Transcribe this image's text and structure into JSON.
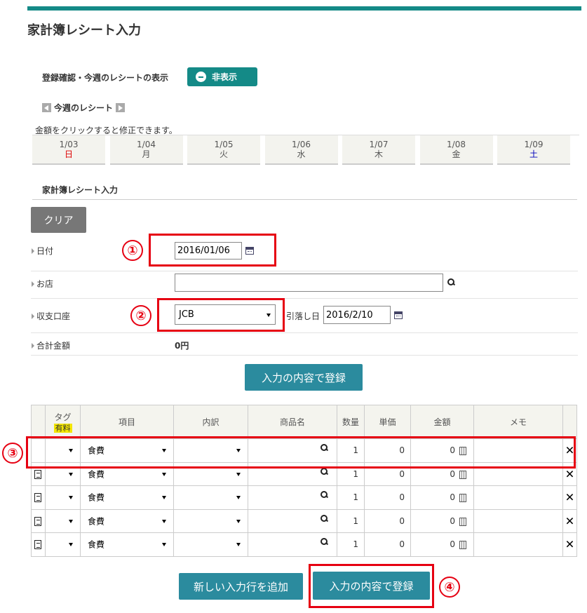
{
  "page": {
    "title": "家計簿レシート入力"
  },
  "confirm": {
    "label": "登録確認・今週のレシートの表示",
    "hide_button": "非表示"
  },
  "week": {
    "label": "今週のレシート",
    "note": "金額をクリックすると修正できます。",
    "days": [
      {
        "date": "1/03",
        "dow": "日"
      },
      {
        "date": "1/04",
        "dow": "月"
      },
      {
        "date": "1/05",
        "dow": "火"
      },
      {
        "date": "1/06",
        "dow": "水"
      },
      {
        "date": "1/07",
        "dow": "木"
      },
      {
        "date": "1/08",
        "dow": "金"
      },
      {
        "date": "1/09",
        "dow": "土"
      }
    ]
  },
  "form": {
    "section_title": "家計簿レシート入力",
    "clear_button": "クリア",
    "date_label": "日付",
    "date_value": "2016/01/06",
    "shop_label": "お店",
    "shop_value": "",
    "account_label": "収支口座",
    "account_value": "JCB",
    "withdraw_label": "引落し日",
    "withdraw_value": "2016/2/10",
    "total_label": "合計金額",
    "total_value": "0円",
    "register_button": "入力の内容で登録"
  },
  "table": {
    "headers": {
      "tag": "タグ",
      "paid": "有料",
      "item": "項目",
      "detail": "内訳",
      "product": "商品名",
      "qty": "数量",
      "unit": "単価",
      "amount": "金額",
      "memo": "メモ"
    },
    "rows": [
      {
        "item": "食費",
        "qty": "1",
        "unit": "0",
        "amount": "0"
      },
      {
        "item": "食費",
        "qty": "1",
        "unit": "0",
        "amount": "0"
      },
      {
        "item": "食費",
        "qty": "1",
        "unit": "0",
        "amount": "0"
      },
      {
        "item": "食費",
        "qty": "1",
        "unit": "0",
        "amount": "0"
      },
      {
        "item": "食費",
        "qty": "1",
        "unit": "0",
        "amount": "0"
      }
    ]
  },
  "footer": {
    "add_row_button": "新しい入力行を追加",
    "register_button": "入力の内容で登録"
  },
  "markers": [
    "①",
    "②",
    "③",
    "④"
  ],
  "colors": {
    "teal": "#148a87",
    "button": "#2b8b9e",
    "highlight": "#e60012",
    "badge": "#f3e600"
  }
}
